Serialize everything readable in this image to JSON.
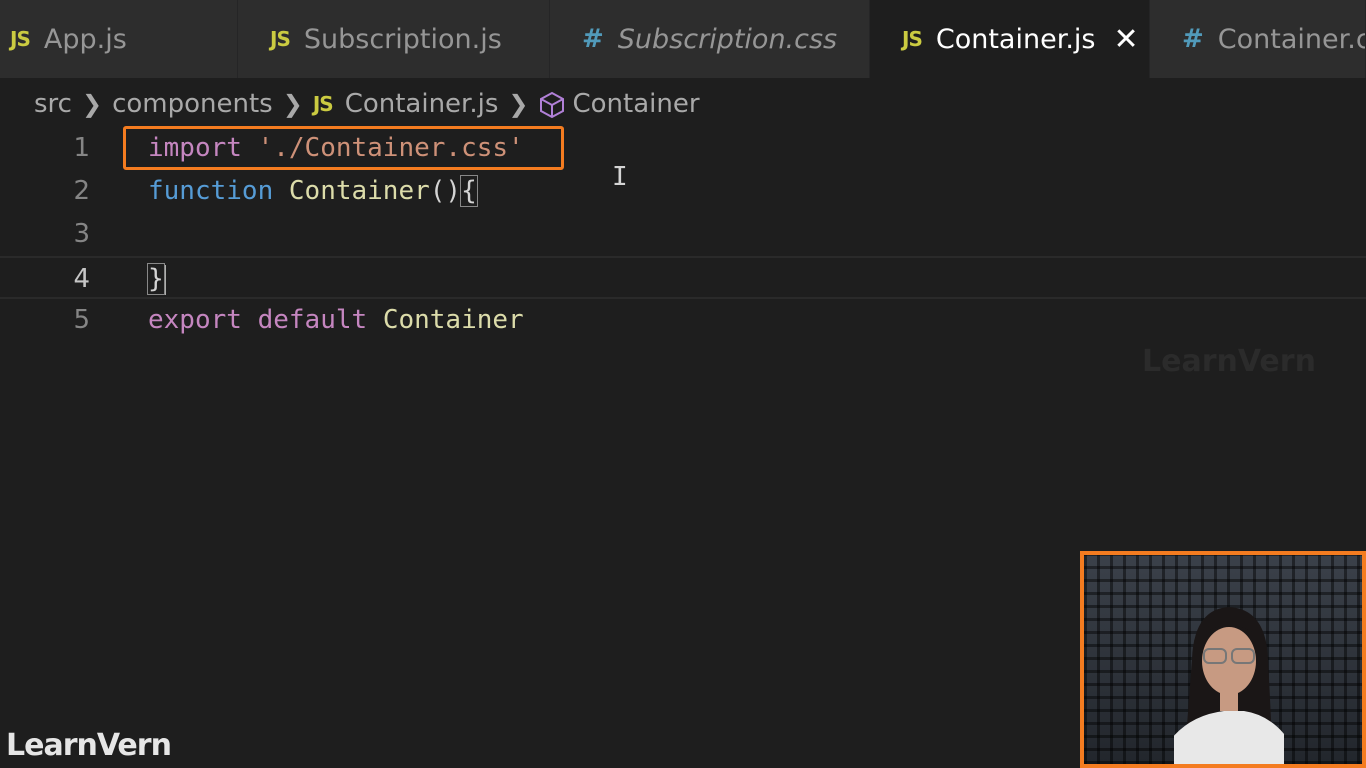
{
  "tabs": [
    {
      "icon": "js-icon",
      "label": "App.js",
      "active": false
    },
    {
      "icon": "js-icon",
      "label": "Subscription.js",
      "active": false
    },
    {
      "icon": "css-icon",
      "label": "Subscription.css",
      "active": false
    },
    {
      "icon": "js-icon",
      "label": "Container.js",
      "active": true
    },
    {
      "icon": "css-icon",
      "label": "Container.css",
      "active": false
    }
  ],
  "icons": {
    "js": "JS",
    "hash": "#"
  },
  "breadcrumb": {
    "items": [
      "src",
      "components",
      "Container.js",
      "Container"
    ]
  },
  "editor": {
    "lines": [
      {
        "number": "1",
        "tokens": [
          "import",
          " ",
          "'./Container.css'"
        ]
      },
      {
        "number": "2",
        "tokens": [
          "function",
          " ",
          "Container",
          "()",
          "{"
        ]
      },
      {
        "number": "3",
        "tokens": []
      },
      {
        "number": "4",
        "tokens": [
          "}"
        ]
      },
      {
        "number": "5",
        "tokens": [
          "export",
          " ",
          "default",
          " ",
          "Container"
        ]
      }
    ],
    "current_line": "4"
  },
  "watermark": {
    "brand": "LearnVern"
  },
  "colors": {
    "accent_highlight": "#f47c20",
    "editor_bg": "#1e1e1e",
    "js_icon": "#cbcb41",
    "css_icon": "#519aba"
  }
}
